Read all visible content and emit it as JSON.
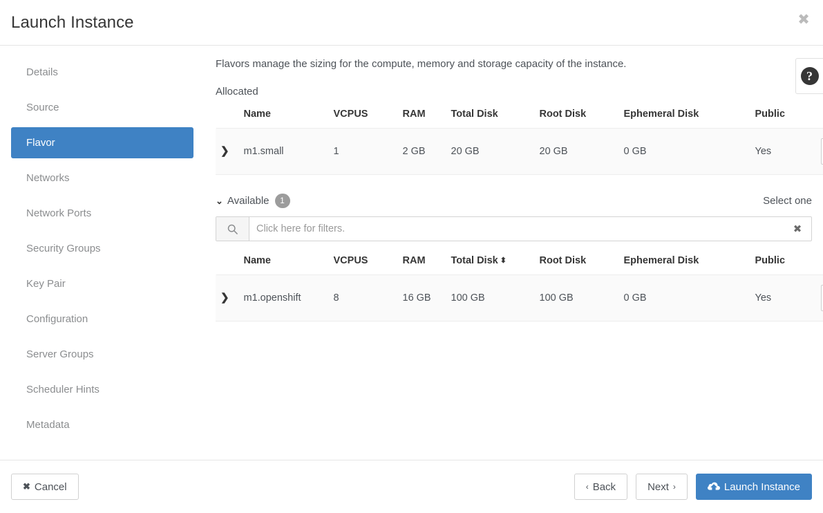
{
  "dialog": {
    "title": "Launch Instance",
    "close_label": "✖",
    "help_label": "?"
  },
  "sidebar": {
    "items": [
      {
        "label": "Details",
        "active": false
      },
      {
        "label": "Source",
        "active": false
      },
      {
        "label": "Flavor",
        "active": true
      },
      {
        "label": "Networks",
        "active": false
      },
      {
        "label": "Network Ports",
        "active": false
      },
      {
        "label": "Security Groups",
        "active": false
      },
      {
        "label": "Key Pair",
        "active": false
      },
      {
        "label": "Configuration",
        "active": false
      },
      {
        "label": "Server Groups",
        "active": false
      },
      {
        "label": "Scheduler Hints",
        "active": false
      },
      {
        "label": "Metadata",
        "active": false
      }
    ]
  },
  "main": {
    "intro": "Flavors manage the sizing for the compute, memory and storage capacity of the instance.",
    "allocated_label": "Allocated",
    "available_label": "Available",
    "available_count": "1",
    "select_one_label": "Select one",
    "caret_collapsed": "❯",
    "caret_expanded": "⌄",
    "sort_glyph": "⬍",
    "remove_glyph": "−",
    "add_glyph": "✛"
  },
  "filter": {
    "placeholder": "Click here for filters.",
    "value": "",
    "search_icon": "search-icon",
    "clear_label": "✖"
  },
  "allocated_table": {
    "columns": [
      "Name",
      "VCPUS",
      "RAM",
      "Total Disk",
      "Root Disk",
      "Ephemeral Disk",
      "Public"
    ],
    "rows": [
      {
        "name": "m1.small",
        "vcpus": "1",
        "ram": "2 GB",
        "total_disk": "20 GB",
        "root_disk": "20 GB",
        "ephemeral_disk": "0 GB",
        "public": "Yes"
      }
    ]
  },
  "available_table": {
    "columns": [
      "Name",
      "VCPUS",
      "RAM",
      "Total Disk",
      "Root Disk",
      "Ephemeral Disk",
      "Public"
    ],
    "sorted_column": "Total Disk",
    "rows": [
      {
        "name": "m1.openshift",
        "vcpus": "8",
        "ram": "16 GB",
        "total_disk": "100 GB",
        "root_disk": "100 GB",
        "ephemeral_disk": "0 GB",
        "public": "Yes"
      }
    ]
  },
  "footer": {
    "cancel_label": "Cancel",
    "cancel_glyph": "✖",
    "back_label": "Back",
    "back_glyph": "‹",
    "next_label": "Next",
    "next_glyph": "›",
    "launch_label": "Launch Instance"
  },
  "colors": {
    "accent": "#3f82c4",
    "text": "#4d5258",
    "heading": "#363636",
    "muted": "#8b8d8f",
    "row_bg": "#fafafa",
    "badge": "#9c9c9c"
  }
}
